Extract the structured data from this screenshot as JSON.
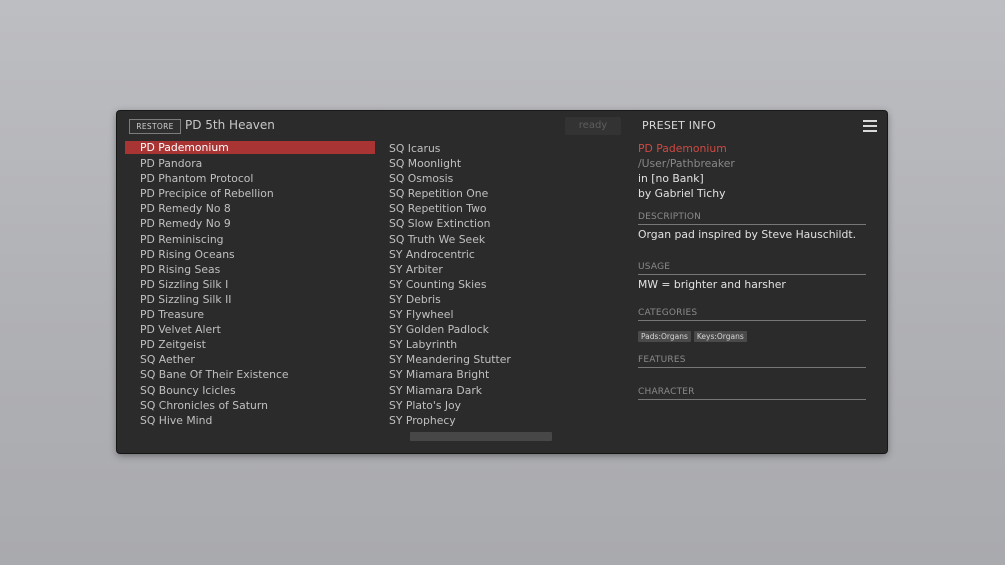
{
  "header": {
    "restore_label": "RESTORE",
    "current_preset": "PD 5th Heaven",
    "status": "ready",
    "info_title": "PRESET INFO"
  },
  "preset_list": {
    "left": [
      "PD Pademonium",
      "PD Pandora",
      "PD Phantom Protocol",
      "PD Precipice of Rebellion",
      "PD Remedy No 8",
      "PD Remedy No 9",
      "PD Reminiscing",
      "PD Rising Oceans",
      "PD Rising Seas",
      "PD Sizzling Silk I",
      "PD Sizzling Silk II",
      "PD Treasure",
      "PD Velvet Alert",
      "PD Zeitgeist",
      "SQ Aether",
      "SQ Bane Of Their Existence",
      "SQ Bouncy Icicles",
      "SQ Chronicles of Saturn",
      "SQ Hive Mind"
    ],
    "right": [
      "SQ Icarus",
      "SQ Moonlight",
      "SQ Osmosis",
      "SQ Repetition One",
      "SQ Repetition Two",
      "SQ Slow Extinction",
      "SQ Truth We Seek",
      "SY Androcentric",
      "SY Arbiter",
      "SY Counting Skies",
      "SY Debris",
      "SY Flywheel",
      "SY Golden Padlock",
      "SY Labyrinth",
      "SY Meandering Stutter",
      "SY Miamara Bright",
      "SY Miamara Dark",
      "SY Plato's Joy",
      "SY Prophecy"
    ],
    "selected": "PD Pademonium"
  },
  "info": {
    "name": "PD Pademonium",
    "path": "/User/Pathbreaker",
    "bank": "in [no Bank]",
    "author": "by Gabriel Tichy",
    "description_title": "DESCRIPTION",
    "description": "Organ pad inspired by Steve Hauschildt.",
    "usage_title": "USAGE",
    "usage": "MW = brighter and harsher",
    "categories_title": "CATEGORIES",
    "categories": [
      "Pads:Organs",
      "Keys:Organs"
    ],
    "features_title": "FEATURES",
    "character_title": "CHARACTER"
  },
  "colors": {
    "selection": "#a83434",
    "name_accent": "#cf4a42",
    "panel_bg": "#2b2b2b"
  },
  "icons": {
    "menu": "hamburger-menu-icon"
  }
}
